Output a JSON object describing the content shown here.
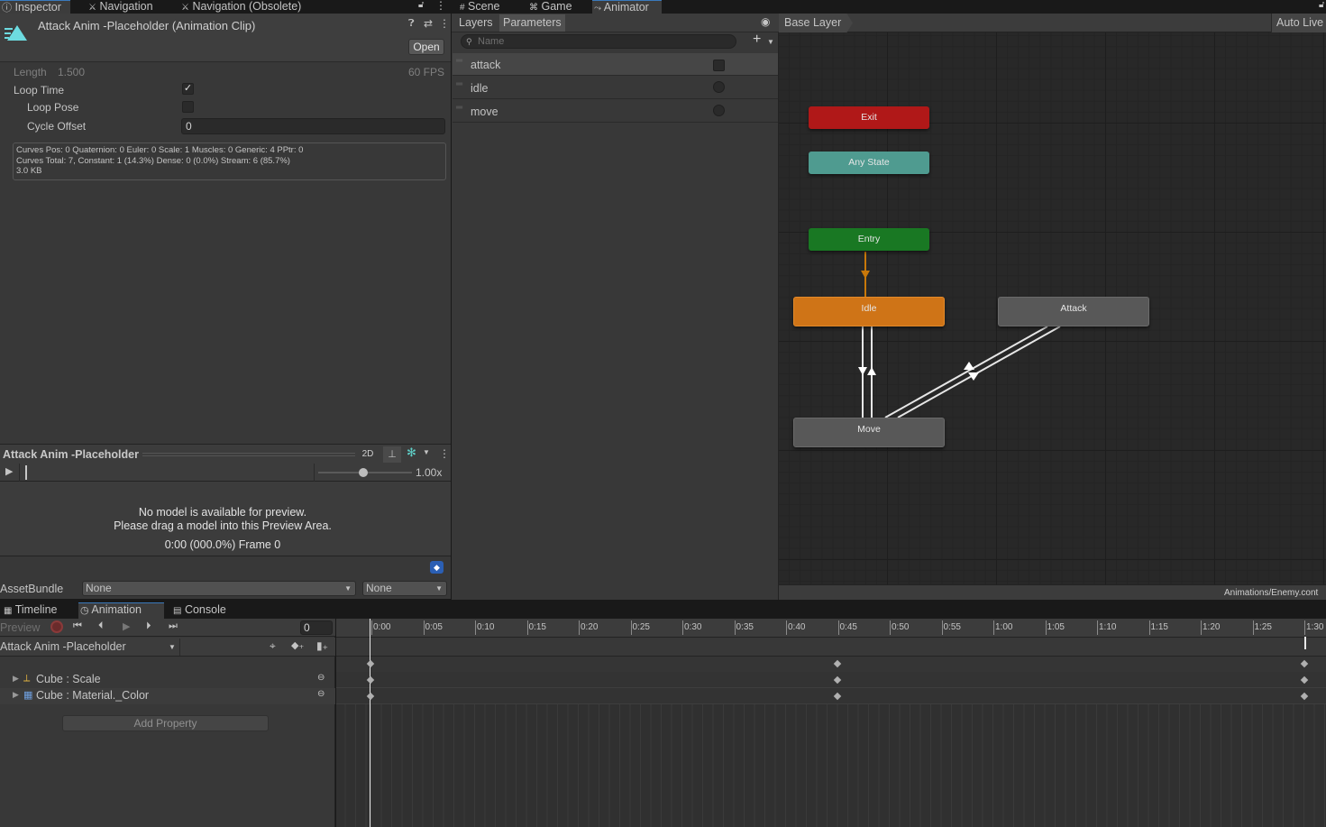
{
  "top_tabs_left": [
    "Inspector",
    "Navigation",
    "Navigation (Obsolete)"
  ],
  "top_tabs_right": [
    "Scene",
    "Game",
    "Animator"
  ],
  "inspector": {
    "title": "Attack Anim -Placeholder (Animation Clip)",
    "open_label": "Open",
    "length_label": "Length",
    "length_value": "1.500",
    "fps": "60 FPS",
    "loop_time_label": "Loop Time",
    "loop_time_checked": "✓",
    "loop_pose_label": "Loop Pose",
    "cycle_offset_label": "Cycle Offset",
    "cycle_offset_value": "0",
    "info_lines": [
      "Curves Pos: 0 Quaternion: 0 Euler: 0 Scale: 1 Muscles: 0 Generic: 4 PPtr: 0",
      "Curves Total: 7, Constant: 1 (14.3%) Dense: 0 (0.0%) Stream: 6 (85.7%)",
      "3.0 KB"
    ]
  },
  "preview": {
    "title": "Attack Anim -Placeholder",
    "mode_2d": "2D",
    "speed": "1.00x",
    "message_line1": "No model is available for preview.",
    "message_line2": "Please drag a model into this Preview Area.",
    "time_readout": "0:00 (000.0%) Frame 0"
  },
  "asset_bundle": {
    "label": "AssetBundle",
    "name_value": "None",
    "variant_value": "None"
  },
  "animator": {
    "tab_layers": "Layers",
    "tab_parameters": "Parameters",
    "search_placeholder": "Name",
    "parameters": [
      {
        "name": "attack",
        "type": "trigger"
      },
      {
        "name": "idle",
        "type": "circle"
      },
      {
        "name": "move",
        "type": "circle"
      }
    ],
    "breadcrumb": "Base Layer",
    "auto_live": "Auto Live",
    "footer_path": "Animations/Enemy.cont",
    "states": {
      "exit": "Exit",
      "any_state": "Any State",
      "entry": "Entry",
      "idle": "Idle",
      "attack": "Attack",
      "move": "Move"
    }
  },
  "bottom_tabs": [
    "Timeline",
    "Animation",
    "Console"
  ],
  "animation": {
    "preview_label": "Preview",
    "frame_value": "0",
    "clip_name": "Attack Anim -Placeholder",
    "properties": [
      "Cube : Scale",
      "Cube : Material._Color"
    ],
    "add_property": "Add Property",
    "ticks": [
      "0:00",
      "0:05",
      "0:10",
      "0:15",
      "0:20",
      "0:25",
      "0:30",
      "0:35",
      "0:40",
      "0:45",
      "0:50",
      "0:55",
      "1:00",
      "1:05",
      "1:10",
      "1:15",
      "1:20",
      "1:25",
      "1:30"
    ]
  },
  "colors": {
    "exit_node": "#b21c1c",
    "any_state_node": "#4b9a8e",
    "entry_node": "#1f7a2a",
    "idle_node": "#c86e15",
    "default_node": "#575757",
    "accent": "#3a79bb"
  }
}
